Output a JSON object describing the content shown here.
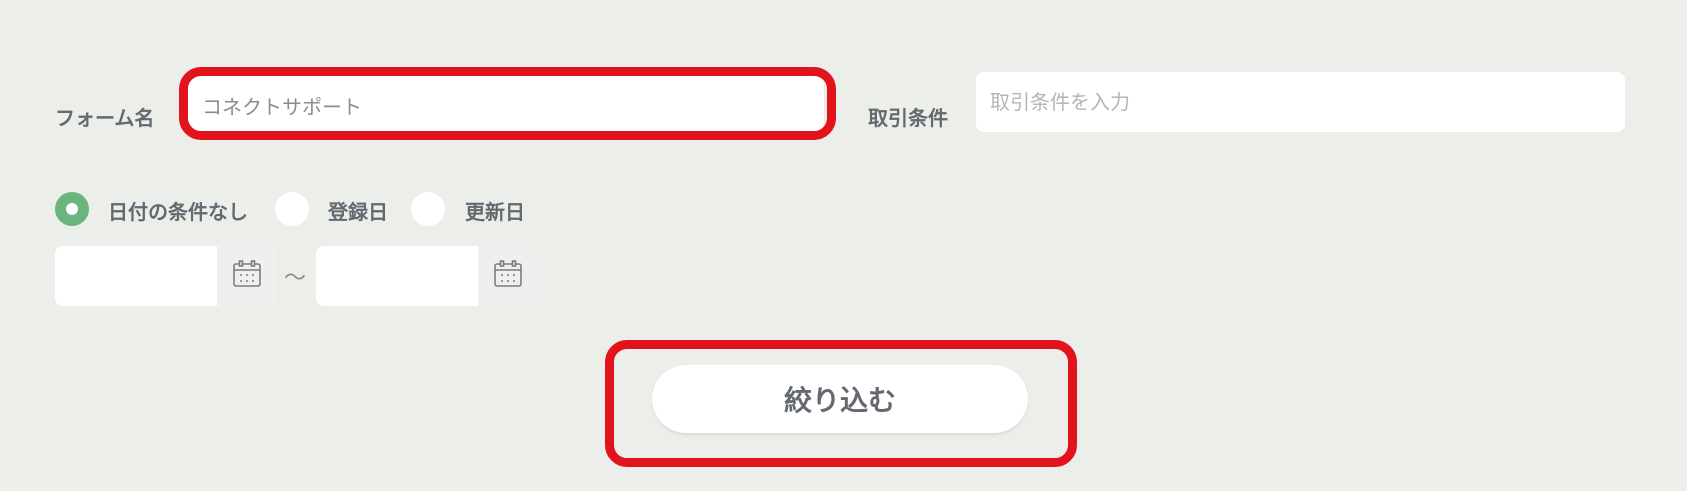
{
  "form_name": {
    "label": "フォーム名",
    "value": "コネクトサポート"
  },
  "trade_terms": {
    "label": "取引条件",
    "placeholder": "取引条件を入力",
    "value": ""
  },
  "date_filter": {
    "options": [
      {
        "label": "日付の条件なし",
        "checked": true
      },
      {
        "label": "登録日",
        "checked": false
      },
      {
        "label": "更新日",
        "checked": false
      }
    ],
    "range_separator": "～",
    "from_value": "",
    "to_value": ""
  },
  "icons": {
    "calendar": "calendar-icon"
  },
  "submit": {
    "label": "絞り込む"
  },
  "colors": {
    "background": "#eceee9",
    "highlight": "#e3131d",
    "radio_checked": "#6cb47f"
  }
}
